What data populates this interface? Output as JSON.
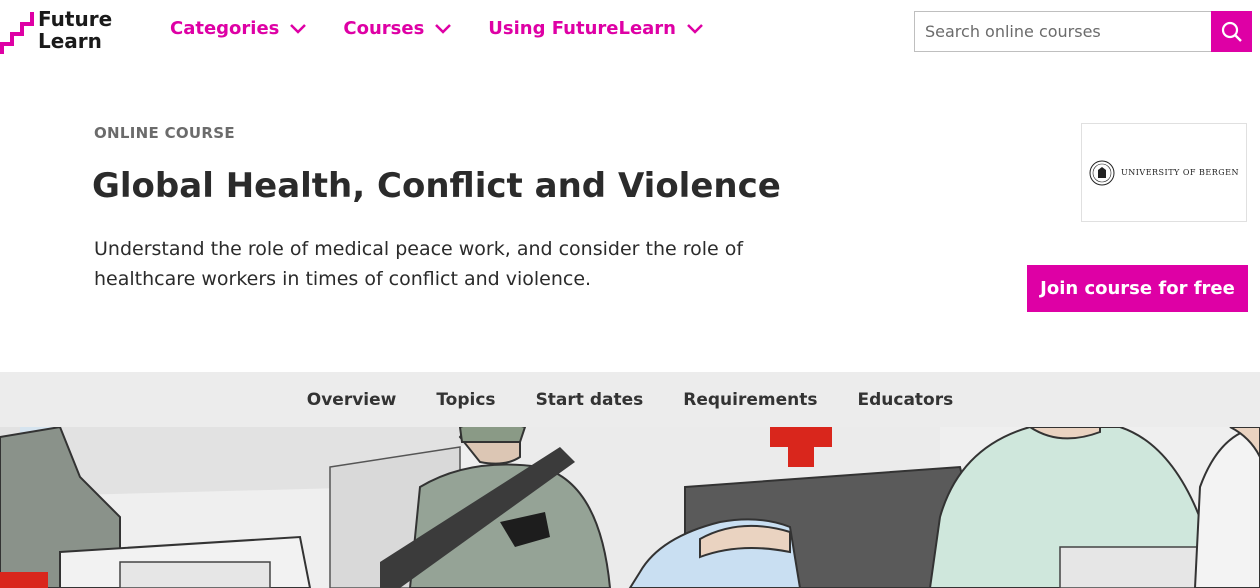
{
  "brand": {
    "logo_line1": "Future",
    "logo_line2": "Learn",
    "accent": "#de00a5"
  },
  "nav": {
    "items": [
      {
        "label": "Categories",
        "icon": "chevron-down-icon"
      },
      {
        "label": "Courses",
        "icon": "chevron-down-icon"
      },
      {
        "label": "Using FutureLearn",
        "icon": "chevron-down-icon"
      }
    ]
  },
  "search": {
    "placeholder": "Search online courses",
    "value": "",
    "icon": "search-icon"
  },
  "course": {
    "kicker": "ONLINE COURSE",
    "title": "Global Health, Conflict and Violence",
    "description": "Understand the role of medical peace work, and consider the role of healthcare workers in times of conflict and violence.",
    "provider": "UNIVERSITY OF BERGEN",
    "join_label": "Join course for free"
  },
  "tabs": [
    "Overview",
    "Topics",
    "Start dates",
    "Requirements",
    "Educators"
  ]
}
